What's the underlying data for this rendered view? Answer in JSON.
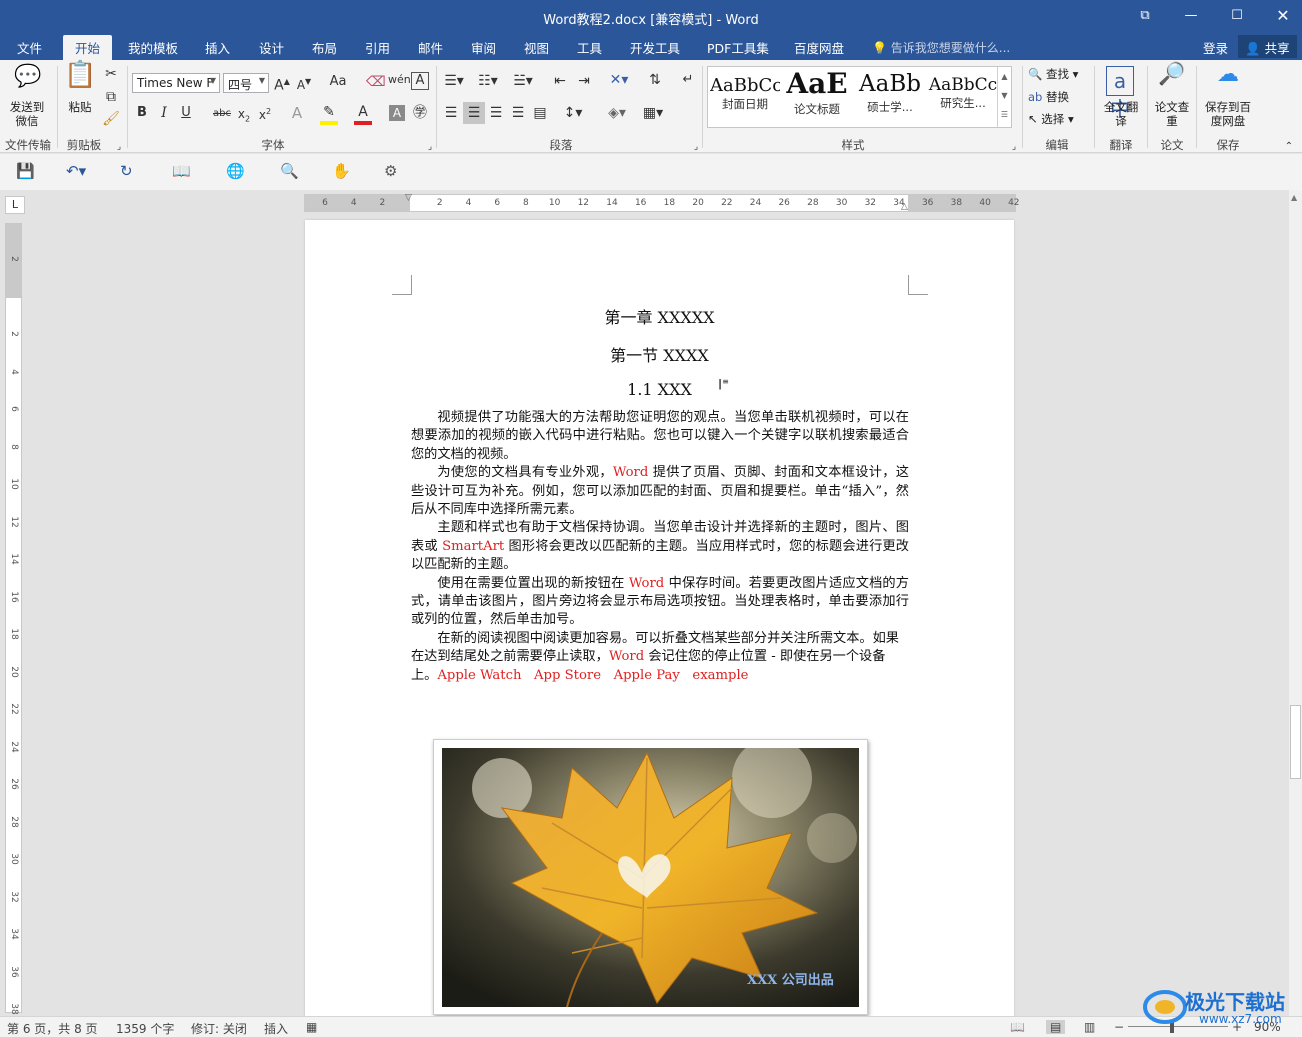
{
  "window": {
    "title": "Word教程2.docx [兼容模式] - Word"
  },
  "tabs": [
    {
      "id": "file",
      "label": "文件"
    },
    {
      "id": "home",
      "label": "开始"
    },
    {
      "id": "templates",
      "label": "我的模板"
    },
    {
      "id": "insert",
      "label": "插入"
    },
    {
      "id": "design",
      "label": "设计"
    },
    {
      "id": "layout",
      "label": "布局"
    },
    {
      "id": "references",
      "label": "引用"
    },
    {
      "id": "mailings",
      "label": "邮件"
    },
    {
      "id": "review",
      "label": "审阅"
    },
    {
      "id": "view",
      "label": "视图"
    },
    {
      "id": "tools",
      "label": "工具"
    },
    {
      "id": "developer",
      "label": "开发工具"
    },
    {
      "id": "pdf",
      "label": "PDF工具集"
    },
    {
      "id": "baidu",
      "label": "百度网盘"
    }
  ],
  "tell_me": "告诉我您想要做什么...",
  "login": "登录",
  "share": "共享",
  "ribbon": {
    "send_wechat": "发送到微信",
    "paste": "粘贴",
    "font_name": "Times New F",
    "font_size": "四号",
    "change_case": "Aa",
    "find": "查找",
    "replace": "替换",
    "select": "选择",
    "full_translate": "全文翻译",
    "paper_check": "论文查重",
    "save_baidu": "保存到百度网盘",
    "groups": {
      "file_transfer": "文件传输",
      "clipboard": "剪贴板",
      "font": "字体",
      "paragraph": "段落",
      "styles": "样式",
      "editing": "编辑",
      "translate": "翻译",
      "paper": "论文",
      "save": "保存"
    },
    "styles": [
      {
        "preview": "AaBbCc",
        "name": "封面日期"
      },
      {
        "preview": "AaE",
        "name": "论文标题"
      },
      {
        "preview": "AaBb",
        "name": "硕士学..."
      },
      {
        "preview": "AaBbCc",
        "name": "研究生..."
      }
    ]
  },
  "document": {
    "chapter": "第一章  XXXXX",
    "section": "第一节  XXXX",
    "subsection": "1.1 XXX",
    "p1": "视频提供了功能强大的方法帮助您证明您的观点。当您单击联机视频时，可以在想要添加的视频的嵌入代码中进行粘贴。您也可以键入一个关键字以联机搜索最适合您的文档的视频。",
    "p2_a": "为使您的文档具有专业外观，",
    "p2_red": "Word",
    "p2_b": " 提供了页眉、页脚、封面和文本框设计，这些设计可互为补充。例如，您可以添加匹配的封面、页眉和提要栏。单击“插入”，然后从不同库中选择所需元素。",
    "p3_a": "主题和样式也有助于文档保持协调。当您单击设计并选择新的主题时，图片、图表或 ",
    "p3_red": "SmartArt",
    "p3_b": " 图形将会更改以匹配新的主题。当应用样式时，您的标题会进行更改以匹配新的主题。",
    "p4_a": "使用在需要位置出现的新按钮在 ",
    "p4_red": "Word",
    "p4_b": " 中保存时间。若要更改图片适应文档的方式，请单击该图片，图片旁边将会显示布局选项按钮。当处理表格时，单击要添加行或列的位置，然后单击加号。",
    "p5_a": "在新的阅读视图中阅读更加容易。可以折叠文档某些部分并关注所需文本。如果在达到结尾处之前需要停止读取，",
    "p5_red": "Word",
    "p5_b": " 会记住您的停止位置 - 即使在另一个设备上。",
    "p5_terms": [
      "Apple Watch",
      "App Store",
      "Apple Pay",
      "example"
    ],
    "image_credit": "XXX 公司出品"
  },
  "ruler": {
    "h_ticks": [
      "6",
      "4",
      "2",
      "",
      "2",
      "4",
      "6",
      "8",
      "10",
      "12",
      "14",
      "16",
      "18",
      "20",
      "22",
      "24",
      "26",
      "28",
      "30",
      "32",
      "34",
      "36",
      "38",
      "40",
      "42"
    ],
    "v_ticks": [
      "2",
      "",
      "2",
      "4",
      "6",
      "8",
      "10",
      "12",
      "14",
      "16",
      "18",
      "20",
      "22",
      "24",
      "26",
      "28",
      "30",
      "32",
      "34",
      "36",
      "38"
    ]
  },
  "status": {
    "page": "第 6 页，共 8 页",
    "words": "1359 个字",
    "track": "修订: 关闭",
    "mode": "插入",
    "zoom": "90%"
  },
  "watermark": {
    "main": "极光下载站",
    "url": "www.xz7.com"
  },
  "colors": {
    "brand": "#2b579a",
    "accent_red": "#e02020"
  }
}
